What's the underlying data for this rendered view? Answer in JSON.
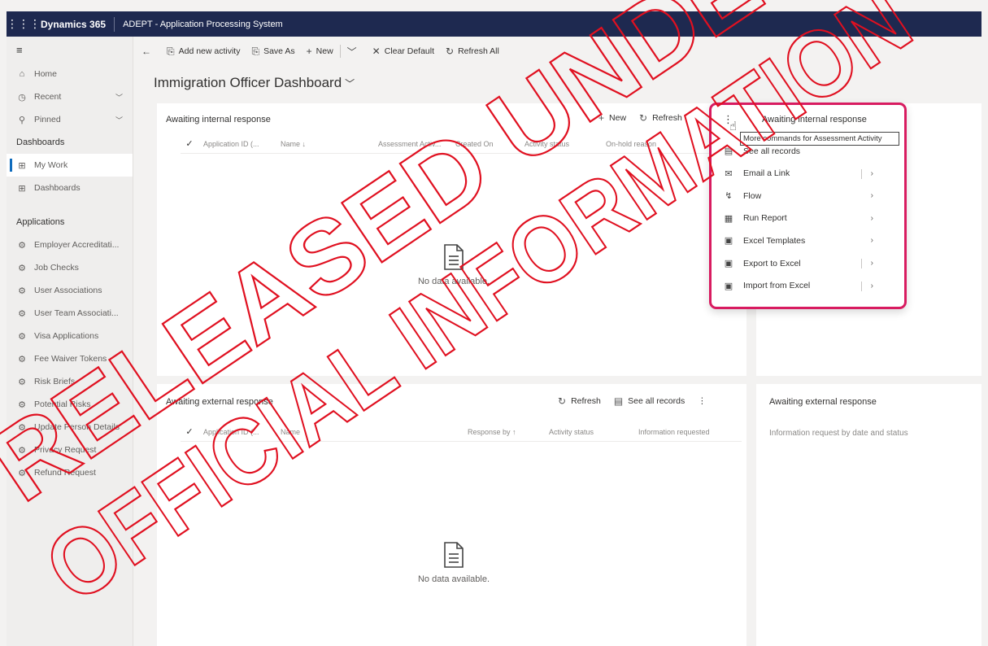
{
  "topbar": {
    "brand": "Dynamics 365",
    "app_name": "ADEPT - Application Processing System"
  },
  "sidebar": {
    "top_items": [
      {
        "label": "Home",
        "icon": "home-icon"
      },
      {
        "label": "Recent",
        "icon": "clock-icon"
      },
      {
        "label": "Pinned",
        "icon": "pin-icon"
      }
    ],
    "dashboards_section": "Dashboards",
    "dashboard_items": [
      {
        "label": "My Work"
      },
      {
        "label": "Dashboards"
      }
    ],
    "applications_section": "Applications",
    "application_items": [
      "Employer Accreditati...",
      "Job Checks",
      "User Associations",
      "User Team Associati...",
      "Visa Applications",
      "Fee Waiver Tokens",
      "Risk Briefs",
      "Potential Risks",
      "Update Person Details",
      "Privacy Request",
      "Refund Request"
    ]
  },
  "commandbar": {
    "add_activity": "Add new activity",
    "save_as": "Save As",
    "new": "New",
    "clear_default": "Clear Default",
    "refresh_all": "Refresh All"
  },
  "dashboard_title": "Immigration Officer Dashboard",
  "panel_internal": {
    "title": "Awaiting internal response",
    "new": "New",
    "refresh": "Refresh",
    "columns": [
      "Application ID (...",
      "Name ↓",
      "Assessment Activ...",
      "Created On",
      "Activity status",
      "On-hold reason"
    ],
    "empty": "No data available."
  },
  "panel_external": {
    "title": "Awaiting external response",
    "refresh": "Refresh",
    "see_all": "See all records",
    "columns": [
      "Application ID (...",
      "Name",
      "Response by ↑",
      "Activity status",
      "Information requested"
    ],
    "empty": "No data available."
  },
  "side_panel_external": {
    "title": "Awaiting external response",
    "subtitle": "Information request by date and status"
  },
  "menu": {
    "header": "Awaiting internal response",
    "tooltip": "More commands for Assessment Activity",
    "items": [
      {
        "label": "See all records",
        "icon": "table-icon",
        "arrow": false
      },
      {
        "label": "Email a Link",
        "icon": "email-icon",
        "arrow": true,
        "split": true
      },
      {
        "label": "Flow",
        "icon": "flow-icon",
        "arrow": true,
        "split": false
      },
      {
        "label": "Run Report",
        "icon": "report-icon",
        "arrow": true,
        "split": false
      },
      {
        "label": "Excel Templates",
        "icon": "excel-template-icon",
        "arrow": true,
        "split": false
      },
      {
        "label": "Export to Excel",
        "icon": "excel-export-icon",
        "arrow": true,
        "split": true
      },
      {
        "label": "Import from Excel",
        "icon": "excel-import-icon",
        "arrow": true,
        "split": true
      }
    ]
  },
  "watermark": {
    "line1": "RELEASED UNDER",
    "line2": "OFFICIAL INFORMATION",
    "color": "#e01020"
  }
}
